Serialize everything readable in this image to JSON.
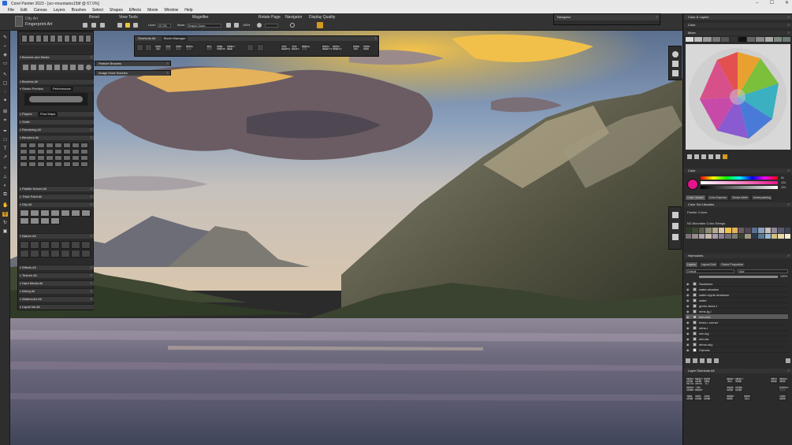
{
  "titlebar": {
    "title": "Corel Painter 2023 - [scr-mountains15tif @ 67.0%]",
    "min": "–",
    "max": "☐",
    "close": "✕"
  },
  "menu": [
    "File",
    "Edit",
    "Canvas",
    "Layers",
    "Brushes",
    "Select",
    "Shapes",
    "Effects",
    "Movie",
    "Window",
    "Help"
  ],
  "propbar": {
    "variant_category": "Oily Art",
    "variant_name": "Fingerprint Art",
    "reset": "Reset",
    "view_tools": "View Tools",
    "magnifier": "Magnifier",
    "level_label": "Level:",
    "level_value": "67.0%",
    "mode_label": "Mode:",
    "mode_value": "Drag to Zoom",
    "zoom_100": "100%",
    "rotate_page": "Rotate Page",
    "navigator": "Navigator",
    "display_quality": "Display Quality"
  },
  "navigator_panel": {
    "title": "Navigator"
  },
  "left": {
    "brushes_media": "Brushes and Media",
    "brushes_all": "Brushes All",
    "stroke_preview": "Stroke Preview",
    "performance": "Performance",
    "papers": "Papers",
    "flow_maps": "Flow Maps",
    "grain": "Grain",
    "rendering_all": "Rendering All",
    "blenders_all": "Blenders All",
    "palette_knives_all": "Palette Knives All",
    "thick_paint_all": "Thick Paint All",
    "oily_all": "Oily All",
    "nature_all": "Nature All",
    "effects_all": "Effects All",
    "texture_all": "Texture All",
    "hard_media_all": "Hard Media All",
    "inking_all": "Inking All",
    "watercolor_all": "Watercolor All",
    "liquid_ink_all": "Liquid Ink All"
  },
  "shortcuts": {
    "title": "Shortcuts All",
    "brush_manager": "Brush Manager",
    "buttons": [
      "SAVE AS",
      "CUT",
      "COPY",
      "PASTE",
      "FILL",
      "FREE TRANSF",
      "INVERT SELE",
      "CUT SHAPES",
      "CUT HOLES",
      "MERGE",
      "PASTE SELECTED",
      "PASTE SPREAD",
      "ZOOM FIT",
      "ZOOM 100%"
    ]
  },
  "particle_brushes": {
    "title": "Particle Brushes"
  },
  "image_hose": {
    "title": "Image Hose Nozzles"
  },
  "right": {
    "color_layers": "Color & Layers",
    "color_harmony_title": "Color",
    "mixer": "Mixer",
    "color": "Color",
    "color_values": [
      "91",
      "124",
      "124"
    ],
    "tabs_color": [
      "Color Variabi",
      "Color Express",
      "Stroke Attrib",
      "Underpainting"
    ],
    "color_set_libraries": "Color Set Libraries",
    "painter_colors": "Painter Colors",
    "mountain_set": "NZ-Mountain-Color-Swings",
    "harmonies": "Harmonies",
    "tabs_layers": [
      "Layers",
      "Layout Grid",
      "Divine Proportion"
    ],
    "blend_mode": "Default",
    "composite": "Add",
    "opacity": "100%",
    "layers": [
      {
        "name": "Swatches",
        "sel": false
      },
      {
        "name": "water-shadow",
        "sel": false
      },
      {
        "name": "water-ripple-shadows",
        "sel": false
      },
      {
        "name": "water",
        "sel": false
      },
      {
        "name": "green-trees-f",
        "sel": false
      },
      {
        "name": "mtns-fg-l",
        "sel": false
      },
      {
        "name": "mtn-mid",
        "sel": true
      },
      {
        "name": "trees-r-corner",
        "sel": false
      },
      {
        "name": "mtns-r",
        "sel": false
      },
      {
        "name": "mtn-bg",
        "sel": false
      },
      {
        "name": "mtn-far",
        "sel": false
      },
      {
        "name": "demo-sky",
        "sel": false
      },
      {
        "name": "Canvas",
        "sel": false
      }
    ],
    "layer_shortcuts": "Layer Shortcuts All",
    "layer_shortcut_buttons": [
      "SELECT LAYER BELOW",
      "SELECT LAYER ABOVE",
      "SHOW HIDE ALL",
      "",
      "SELECT ALL",
      "SELECT NONE",
      "",
      "",
      "APPLY MASK",
      "DELETE MASK",
      "GROUP LAYERS",
      "UN GROUP",
      "",
      "",
      "CLEAR LAYER",
      "CLONE LAYER",
      "",
      "",
      "",
      "FLATTEN",
      "NEW LAYER",
      "DUPL LAYER",
      "LOCK LAYER",
      "",
      "INVERT MASK",
      "",
      "DROP ALL",
      "",
      "",
      "LOAD MASK"
    ]
  },
  "colors": {
    "accent": "#e8c63a",
    "selected_color": "#e5148c",
    "panel": "#2b2b2b"
  }
}
